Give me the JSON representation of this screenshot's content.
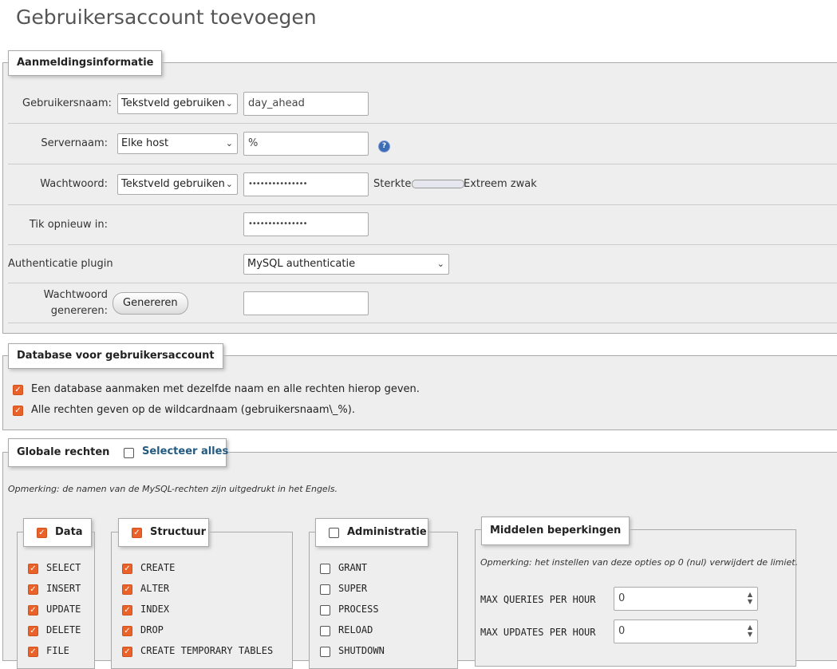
{
  "page": {
    "title": "Gebruikersaccount toevoegen"
  },
  "login": {
    "legend": "Aanmeldingsinformatie",
    "username": {
      "label": "Gebruikersnaam:",
      "select": "Tekstveld gebruiken",
      "value": "day_ahead"
    },
    "host": {
      "label": "Servernaam:",
      "select": "Elke host",
      "value": "%"
    },
    "password": {
      "label": "Wachtwoord:",
      "select": "Tekstveld gebruiken",
      "value": "•••••••••••••••",
      "strength_label": "Sterkte:",
      "strength_value": "Extreem zwak"
    },
    "retype": {
      "label": "Tik opnieuw in:",
      "value": "•••••••••••••••"
    },
    "auth_plugin": {
      "label": "Authenticatie plugin",
      "select": "MySQL authenticatie"
    },
    "generate": {
      "label_line1": "Wachtwoord",
      "label_line2": "genereren:",
      "button": "Genereren",
      "value": ""
    }
  },
  "database": {
    "legend": "Database voor gebruikersaccount",
    "options": [
      {
        "label": "Een database aanmaken met dezelfde naam en alle rechten hierop geven.",
        "checked": true
      },
      {
        "label": "Alle rechten geven op de wildcardnaam (gebruikersnaam\\_%).",
        "checked": true
      }
    ]
  },
  "global": {
    "legend": "Globale rechten",
    "select_all": "Selecteer alles",
    "note": "Opmerking: de namen van de MySQL-rechten zijn uitgedrukt in het Engels.",
    "data": {
      "legend": "Data",
      "items": [
        "SELECT",
        "INSERT",
        "UPDATE",
        "DELETE",
        "FILE"
      ]
    },
    "structure": {
      "legend": "Structuur",
      "items": [
        "CREATE",
        "ALTER",
        "INDEX",
        "DROP",
        "CREATE TEMPORARY TABLES"
      ]
    },
    "admin": {
      "legend": "Administratie",
      "items": [
        "GRANT",
        "SUPER",
        "PROCESS",
        "RELOAD",
        "SHUTDOWN"
      ]
    },
    "resources": {
      "legend": "Middelen beperkingen",
      "note": "Opmerking: het instellen van deze opties op 0 (nul) verwijdert de limiet.",
      "max_queries": {
        "label": "MAX QUERIES PER HOUR",
        "value": "0"
      },
      "max_updates": {
        "label": "MAX UPDATES PER HOUR",
        "value": "0"
      }
    }
  },
  "colors": {
    "checkbox_checked": "#e8622a",
    "link": "#235a81",
    "help": "#3d6db5"
  }
}
